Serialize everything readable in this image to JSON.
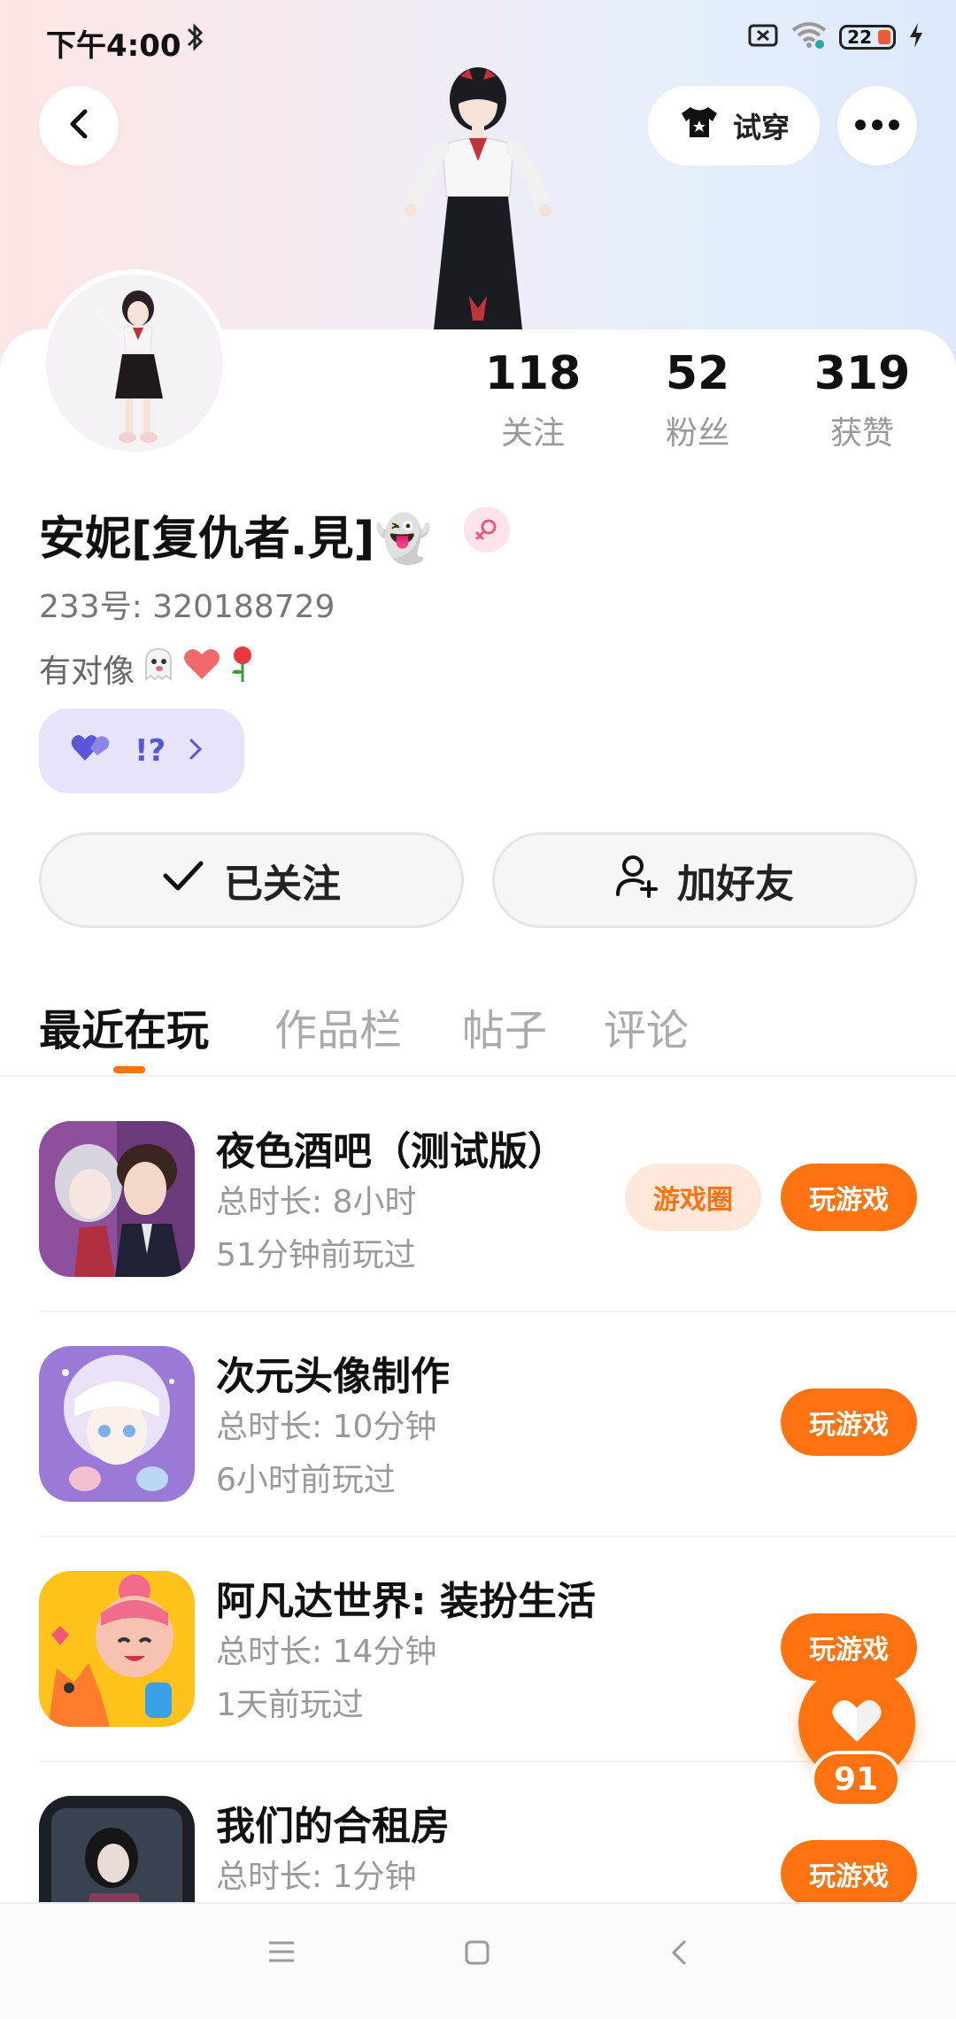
{
  "status_bar": {
    "time": "下午4:00",
    "battery": "22"
  },
  "header": {
    "try_on_label": "试穿"
  },
  "profile": {
    "stats": [
      {
        "value": "118",
        "label": "关注"
      },
      {
        "value": "52",
        "label": "粉丝"
      },
      {
        "value": "319",
        "label": "获赞"
      }
    ],
    "nickname": "安妮[复仇者.見]👻",
    "uid": "233号: 320188729",
    "bio": "有对像",
    "tag_label": "!?",
    "follow_label": "已关注",
    "add_friend_label": "加好友"
  },
  "tabs": [
    {
      "label": "最近在玩",
      "active": true
    },
    {
      "label": "作品栏",
      "active": false
    },
    {
      "label": "帖子",
      "active": false
    },
    {
      "label": "评论",
      "active": false
    }
  ],
  "games": [
    {
      "title": "夜色酒吧（测试版）",
      "duration": "总时长: 8小时",
      "last_played": "51分钟前玩过",
      "circle_label": "游戏圈",
      "play_label": "玩游戏"
    },
    {
      "title": "次元头像制作",
      "duration": "总时长: 10分钟",
      "last_played": "6小时前玩过",
      "play_label": "玩游戏"
    },
    {
      "title": "阿凡达世界: 装扮生活",
      "duration": "总时长: 14分钟",
      "last_played": "1天前玩过",
      "play_label": "玩游戏"
    },
    {
      "title": "我们的合租房",
      "duration": "总时长: 1分钟",
      "last_played": "",
      "play_label": "玩游戏"
    }
  ],
  "like_fab": {
    "count": "91"
  },
  "colors": {
    "accent": "#ff7210",
    "tag_bg": "#e6e3fb",
    "tag_fg": "#5b56d8"
  }
}
